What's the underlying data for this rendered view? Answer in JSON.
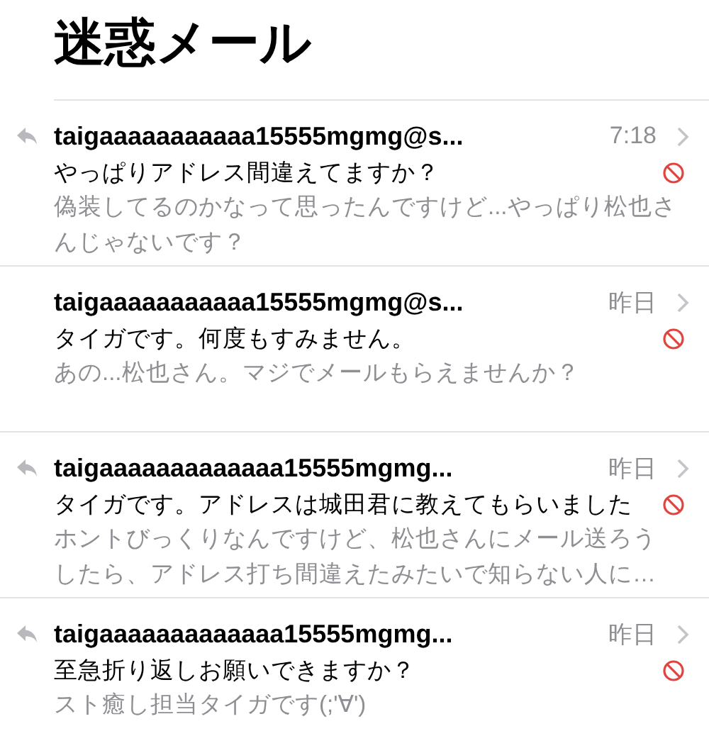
{
  "title": "迷惑メール",
  "messages": [
    {
      "sender": "taigaaaaaaaaaaa15555mgmg@s...",
      "time": "7:18",
      "subject": "やっぱりアドレス間違えてますか？",
      "preview_lines": [
        "偽装してるのかなって思ったんですけど...やっぱり松也さ",
        "んじゃないです？"
      ],
      "replied": true
    },
    {
      "sender": "taigaaaaaaaaaaa15555mgmg@s...",
      "time": "昨日",
      "subject": "タイガです。何度もすみません。",
      "preview_lines": [
        "あの...松也さん。マジでメールもらえませんか？"
      ],
      "replied": false
    },
    {
      "sender": "taigaaaaaaaaaaaaa15555mgmg...",
      "time": "昨日",
      "subject": "タイガです。アドレスは城田君に教えてもらいました",
      "preview_lines": [
        "ホントびっくりなんですけど、松也さんにメール送ろう",
        "したら、アドレス打ち間違えたみたいで知らない人に…"
      ],
      "replied": true
    },
    {
      "sender": "taigaaaaaaaaaaaaa15555mgmg...",
      "time": "昨日",
      "subject": "至急折り返しお願いできますか？",
      "preview_lines": [
        "スト癒し担当タイガです(;'∀')"
      ],
      "replied": true
    }
  ]
}
